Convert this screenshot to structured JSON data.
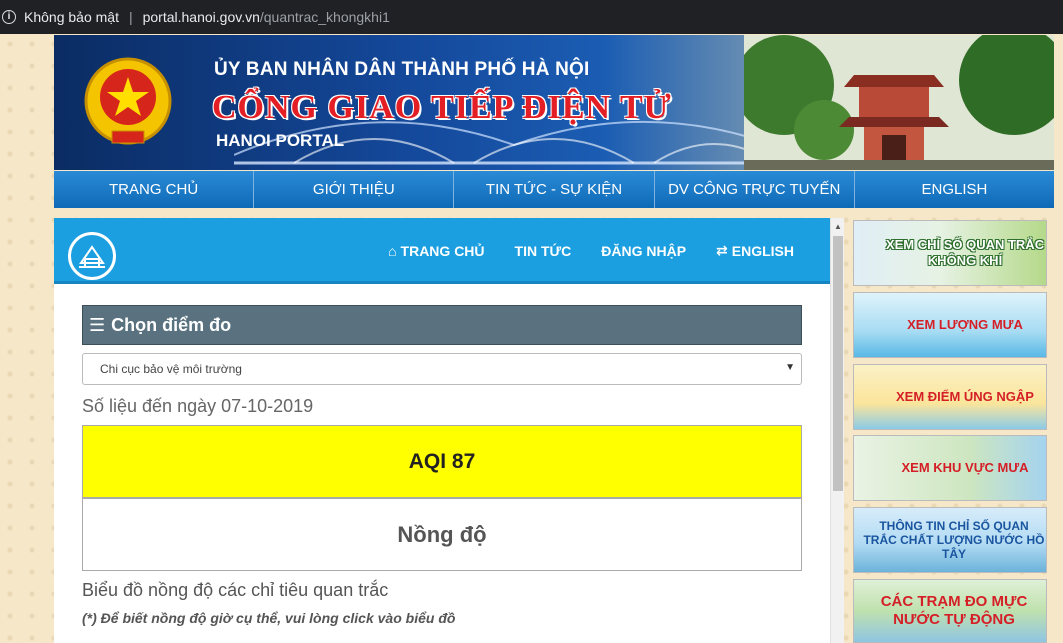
{
  "browser": {
    "security_label": "Không bảo mật",
    "separator": "|",
    "url_host": "portal.hanoi.gov.vn",
    "url_path": "/quantrac_khongkhi1"
  },
  "banner": {
    "subtitle": "ỦY BAN NHÂN DÂN THÀNH PHỐ HÀ NỘI",
    "title": "CỔNG GIAO TIẾP ĐIỆN TỬ",
    "english": "HANOI PORTAL"
  },
  "main_nav": [
    {
      "label": "TRANG CHỦ"
    },
    {
      "label": "GIỚI THIỆU"
    },
    {
      "label": "TIN TỨC - SỰ KIỆN"
    },
    {
      "label": "DV CÔNG TRỰC TUYẾN"
    },
    {
      "label": "ENGLISH"
    }
  ],
  "sub_nav": {
    "home": "TRANG CHỦ",
    "news": "TIN TỨC",
    "login": "ĐĂNG NHẬP",
    "english": "ENGLISH"
  },
  "content": {
    "choose_title": "Chọn điểm đo",
    "select_value": "Chi cục bảo vệ môi trường",
    "data_date": "Số liệu đến ngày 07-10-2019",
    "aqi_label": "AQI 87",
    "aqi_color": "#ffff00",
    "concentration_label": "Nồng độ",
    "chart_heading": "Biểu đồ nồng độ các chỉ tiêu quan trắc",
    "chart_note": "(*) Để biết nồng độ giờ cụ thể, vui lòng click vào biểu đồ"
  },
  "side_banners": {
    "air": "XEM CHỈ SỐ QUAN TRẮC KHÔNG KHÍ",
    "rain": "XEM LƯỢNG MƯA",
    "flood": "XEM ĐIỂM ÚNG NGẬP",
    "rain_area": "XEM KHU VỰC MƯA",
    "west_lake": "THÔNG TIN CHỈ SỐ QUAN TRẮC CHẤT LƯỢNG NƯỚC HỒ TÂY",
    "water_level": "CÁC TRẠM ĐO MỰC NƯỚC TỰ ĐỘNG"
  },
  "colors": {
    "nav_blue": "#1776c4",
    "subheader_blue": "#1c9fe0",
    "choose_bar": "#5a7280",
    "title_red": "#e31e24"
  }
}
